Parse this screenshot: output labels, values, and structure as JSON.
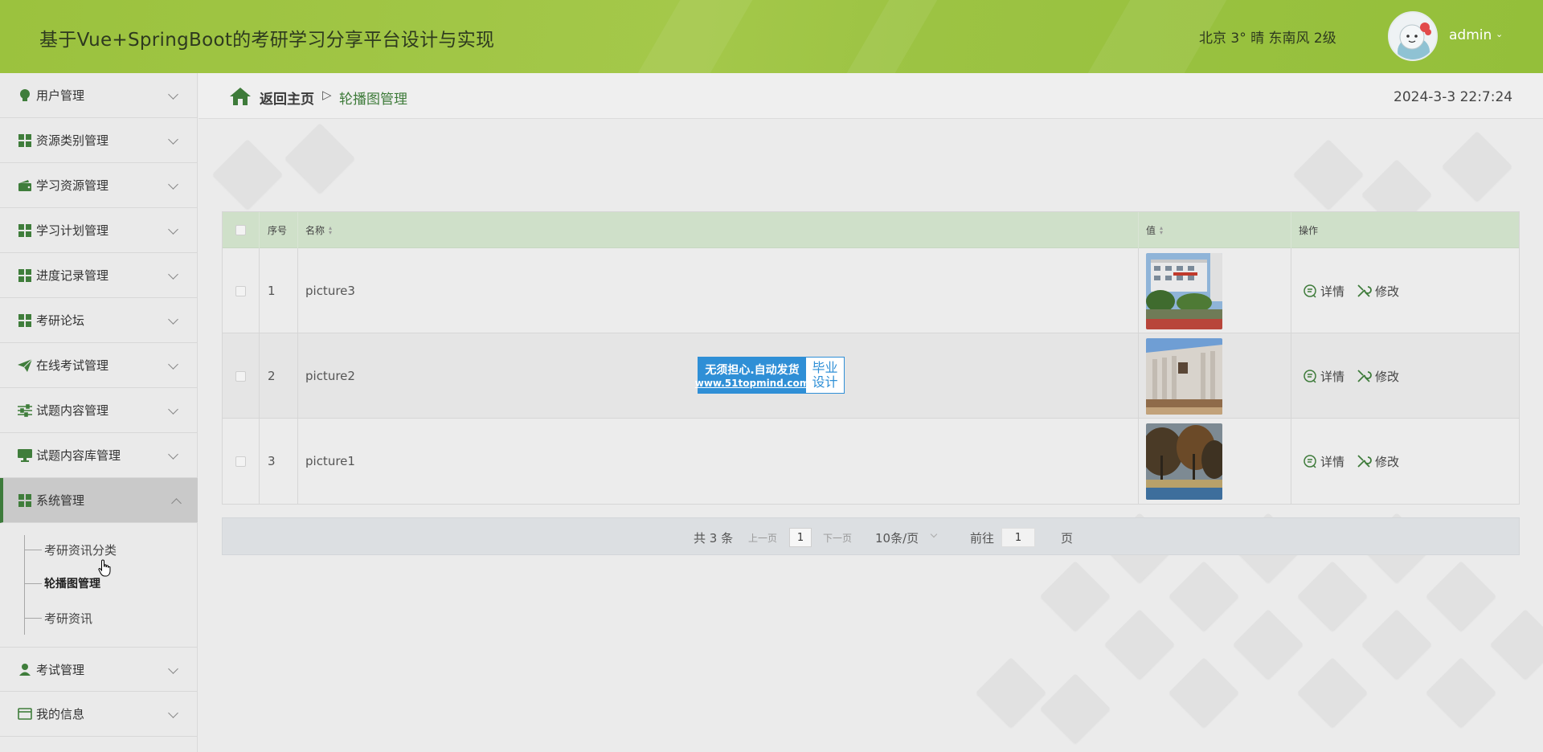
{
  "header": {
    "title": "基于Vue+SpringBoot的考研学习分享平台设计与实现",
    "weather": "北京  3°  晴  东南风  2级",
    "user_name": "admin"
  },
  "sidebar": {
    "items": [
      {
        "label": "用户管理",
        "icon": "lightbulb-icon"
      },
      {
        "label": "资源类别管理",
        "icon": "grid-icon"
      },
      {
        "label": "学习资源管理",
        "icon": "wallet-icon"
      },
      {
        "label": "学习计划管理",
        "icon": "grid-icon"
      },
      {
        "label": "进度记录管理",
        "icon": "grid-icon"
      },
      {
        "label": "考研论坛",
        "icon": "grid-icon"
      },
      {
        "label": "在线考试管理",
        "icon": "paper-plane-icon"
      },
      {
        "label": "试题内容管理",
        "icon": "sliders-icon"
      },
      {
        "label": "试题内容库管理",
        "icon": "monitor-icon"
      },
      {
        "label": "系统管理",
        "icon": "grid-icon"
      },
      {
        "label": "考试管理",
        "icon": "user-icon"
      },
      {
        "label": "我的信息",
        "icon": "card-icon"
      }
    ],
    "sub_items": [
      "考研资讯分类",
      "轮播图管理",
      "考研资讯"
    ]
  },
  "breadcrumb": {
    "home": "返回主页",
    "separator": "▷",
    "current": "轮播图管理"
  },
  "clock": "2024-3-3 22:7:24",
  "table": {
    "headers": {
      "index": "序号",
      "name": "名称",
      "value": "值",
      "actions": "操作"
    },
    "rows": [
      {
        "index": "1",
        "name": "picture3"
      },
      {
        "index": "2",
        "name": "picture2"
      },
      {
        "index": "3",
        "name": "picture1"
      }
    ],
    "action_detail": "详情",
    "action_edit": "修改"
  },
  "pagination": {
    "total": "共 3 条",
    "prev": "上一页",
    "current_page": "1",
    "next": "下一页",
    "page_size": "10条/页",
    "goto_prefix": "前往",
    "goto_value": "1",
    "goto_suffix": "页"
  },
  "watermark": {
    "line1": "无须担心.自动发货",
    "line2": "www.51topmind.com",
    "right1": "毕业",
    "right2": "设计"
  },
  "colors": {
    "header_green": "#9bc23e",
    "accent_green": "#3e7b3a",
    "table_header": "#cfe0c9",
    "badge_blue": "#2f8fd6"
  }
}
